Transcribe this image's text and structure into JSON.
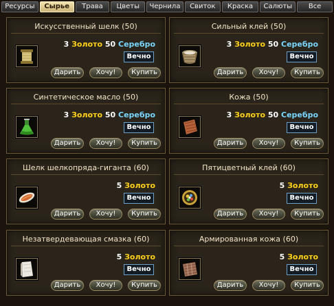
{
  "tabs": [
    {
      "label": "Ресурсы",
      "active": false
    },
    {
      "label": "Сырье",
      "active": true
    },
    {
      "label": "Трава",
      "active": false
    },
    {
      "label": "Цветы",
      "active": false
    },
    {
      "label": "Чернила",
      "active": false
    },
    {
      "label": "Свиток",
      "active": false
    },
    {
      "label": "Краска",
      "active": false
    },
    {
      "label": "Салюты",
      "active": false
    },
    {
      "label": "Все",
      "active": false
    }
  ],
  "buttons": {
    "gift": "Дарить",
    "want": "Хочу!",
    "buy": "Купить"
  },
  "currency": {
    "gold": "Золото",
    "silver": "Серебро"
  },
  "colors": {
    "gold": "#ffd21a",
    "silver": "#7ad7ff",
    "active_tab": "#e8d69c"
  },
  "items": [
    {
      "name": "Искусственный шелк (50)",
      "gold": "3",
      "silver": "50",
      "duration": "Вечно",
      "icon": "silk-thread-spool-icon"
    },
    {
      "name": "Сильный клей (50)",
      "gold": "3",
      "silver": "50",
      "duration": "Вечно",
      "icon": "glue-basket-icon"
    },
    {
      "name": "Синтетическое масло (50)",
      "gold": "3",
      "silver": "50",
      "duration": "Вечно",
      "icon": "green-oil-flask-icon"
    },
    {
      "name": "Кожа (50)",
      "gold": "3",
      "silver": "50",
      "duration": "Вечно",
      "icon": "leather-piece-icon"
    },
    {
      "name": "Шелк шелкопряда-гиганта (60)",
      "gold": "5",
      "silver": "",
      "duration": "Вечно",
      "icon": "silkworm-cocoon-icon"
    },
    {
      "name": "Пятицветный клей (60)",
      "gold": "5",
      "silver": "",
      "duration": "Вечно",
      "icon": "five-color-glue-icon"
    },
    {
      "name": "Незатвердевающая смазка (60)",
      "gold": "5",
      "silver": "",
      "duration": "Вечно",
      "icon": "grease-block-icon"
    },
    {
      "name": "Армированная кожа (60)",
      "gold": "5",
      "silver": "",
      "duration": "Вечно",
      "icon": "reinforced-leather-icon"
    }
  ]
}
